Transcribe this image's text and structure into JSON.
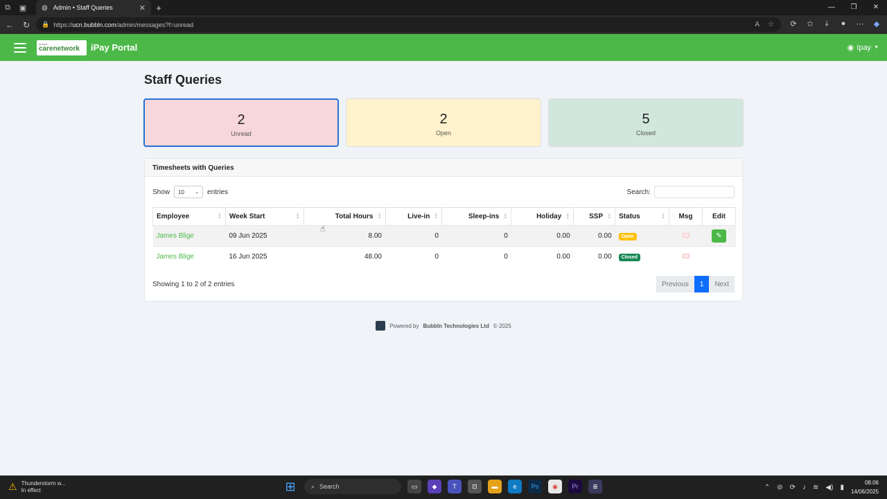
{
  "browser": {
    "tab_title": "Admin • Staff Queries",
    "url_prefix": "https://",
    "url_host": "ucn.bubbln.com",
    "url_path": "/admin/messages?f=unread"
  },
  "navbar": {
    "logo_small": "unique",
    "logo_brand": "carenetwork",
    "title": "iPay Portal",
    "user": "Ipay"
  },
  "page": {
    "title": "Staff Queries"
  },
  "stats": [
    {
      "count": "2",
      "label": "Unread"
    },
    {
      "count": "2",
      "label": "Open"
    },
    {
      "count": "5",
      "label": "Closed"
    }
  ],
  "card": {
    "title": "Timesheets with Queries",
    "show_label": "Show",
    "entries_value": "10",
    "entries_label": "entries",
    "search_label": "Search:",
    "info": "Showing 1 to 2 of 2 entries",
    "pager": {
      "previous": "Previous",
      "current": "1",
      "next": "Next"
    }
  },
  "table": {
    "headers": {
      "employee": "Employee",
      "week_start": "Week Start",
      "total_hours": "Total Hours",
      "live_in": "Live-in",
      "sleep_ins": "Sleep-ins",
      "holiday": "Holiday",
      "ssp": "SSP",
      "status": "Status",
      "msg": "Msg",
      "edit": "Edit"
    },
    "rows": [
      {
        "employee": "James Blige",
        "week_start": "09 Jun 2025",
        "total_hours": "8.00",
        "live_in": "0",
        "sleep_ins": "0",
        "holiday": "0.00",
        "ssp": "0.00",
        "status": "Open"
      },
      {
        "employee": "James Blige",
        "week_start": "16 Jun 2025",
        "total_hours": "48.00",
        "live_in": "0",
        "sleep_ins": "0",
        "holiday": "0.00",
        "ssp": "0.00",
        "status": "Closed"
      }
    ]
  },
  "footer": {
    "prefix": "Powered by",
    "company": "Bubbln Technologies Ltd",
    "suffix": "© 2025"
  },
  "taskbar": {
    "weather_title": "Thunderstorm w...",
    "weather_sub": "In effect",
    "search": "Search",
    "time": "08:06",
    "date": "14/06/2025"
  },
  "colors": {
    "brand_green": "#4cb848",
    "unread_bg": "#f8d7da",
    "open_bg": "#fff3cd",
    "closed_bg": "#d1e7dd",
    "badge_open": "#ffc107",
    "badge_closed": "#198754",
    "pager_active": "#0d6efd"
  }
}
